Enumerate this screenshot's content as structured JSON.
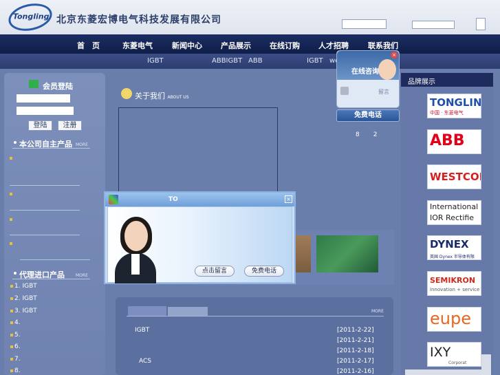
{
  "header": {
    "logo_text": "Tongling",
    "company": "北京东菱宏博电气科技发展有限公司"
  },
  "nav": [
    "首　页",
    "东菱电气",
    "新闻中心",
    "产品展示",
    "在线订购",
    "人才招聘",
    "联系我们"
  ],
  "subnav": [
    "IGBT",
    "ABBIGBT",
    "ABB",
    "IGBT",
    "we"
  ],
  "login": {
    "title": "会员登陆",
    "login_button": "登陆",
    "register_button": "注册"
  },
  "own_products": {
    "title": "本公司自主产品",
    "more": "MORE"
  },
  "agent_products": {
    "title": "代理进口产品",
    "more": "MORE",
    "items": [
      "1. IGBT",
      "2. IGBT",
      "3. IGBT",
      "4.",
      "5.",
      "6.",
      "7.",
      "8."
    ]
  },
  "about": {
    "title": "关于我们",
    "subtitle": "ABOUT US"
  },
  "page_numbers": [
    "8",
    "2"
  ],
  "news": {
    "more": "MORE",
    "items": [
      {
        "text": "IGBT",
        "date": "[2011-2-22]"
      },
      {
        "text": "",
        "date": "[2011-2-21]"
      },
      {
        "text": "",
        "date": "[2011-2-18]"
      },
      {
        "text": "ACS",
        "date": "[2011-2-17]"
      },
      {
        "text": "",
        "date": "[2011-2-16]"
      }
    ]
  },
  "brands": {
    "title": "品牌展示",
    "items": [
      {
        "name": "TONGLIN",
        "sub": "中国 · 东菱电气",
        "color": "#1f4fa8"
      },
      {
        "name": "ABB",
        "sub": "",
        "color": "#e2001a"
      },
      {
        "name": "WESTCOD",
        "sub": "",
        "color": "#d51e1e"
      },
      {
        "name": "International",
        "sub": "IOR Rectifie",
        "color": "#222222"
      },
      {
        "name": "DYNEX",
        "sub": "英国 Dynex 半导体有限",
        "color": "#1b2a68"
      },
      {
        "name": "SEMIKRON",
        "sub": "innovation + service",
        "color": "#d0271c"
      },
      {
        "name": "eupe",
        "sub": "",
        "color": "#e8671f"
      },
      {
        "name": "IXY",
        "sub": "Corporat",
        "color": "#222222"
      }
    ]
  },
  "online_service": {
    "title": "在线咨询",
    "message": "留言",
    "call": "免费电话"
  },
  "popup": {
    "title": "TO",
    "leave_message": "点击留言",
    "free_call": "免费电话"
  }
}
